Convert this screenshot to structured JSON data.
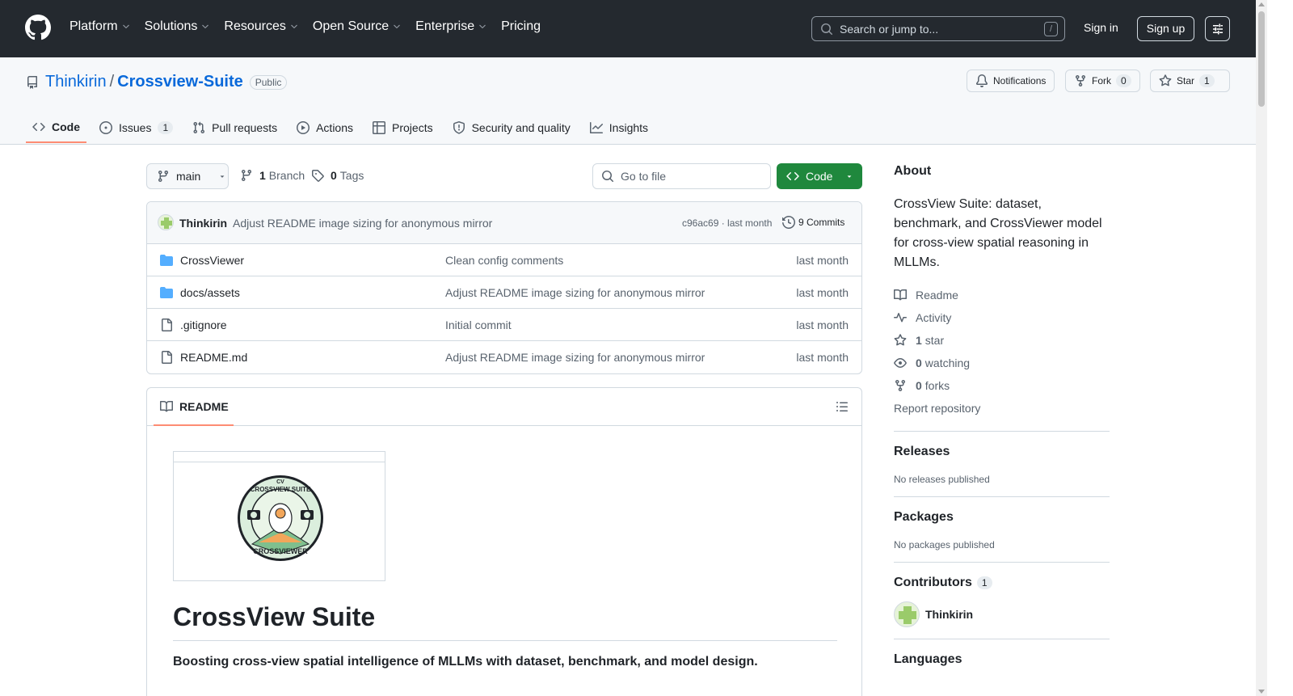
{
  "header": {
    "nav": [
      {
        "label": "Platform",
        "has_dropdown": true
      },
      {
        "label": "Solutions",
        "has_dropdown": true
      },
      {
        "label": "Resources",
        "has_dropdown": true
      },
      {
        "label": "Open Source",
        "has_dropdown": true
      },
      {
        "label": "Enterprise",
        "has_dropdown": true
      },
      {
        "label": "Pricing",
        "has_dropdown": false
      }
    ],
    "search_placeholder": "Search or jump to...",
    "search_shortcut": "/",
    "signin": "Sign in",
    "signup": "Sign up"
  },
  "repo": {
    "owner": "Thinkirin",
    "separator": "/",
    "name": "Crossview-Suite",
    "visibility": "Public",
    "notifications": "Notifications",
    "fork_label": "Fork",
    "fork_count": "0",
    "star_label": "Star",
    "star_count": "1"
  },
  "tabs": [
    {
      "label": "Code",
      "icon": "code-icon",
      "active": true
    },
    {
      "label": "Issues",
      "icon": "issue-icon",
      "count": "1"
    },
    {
      "label": "Pull requests",
      "icon": "pull-request-icon"
    },
    {
      "label": "Actions",
      "icon": "play-icon"
    },
    {
      "label": "Projects",
      "icon": "table-icon"
    },
    {
      "label": "Security and quality",
      "icon": "shield-icon"
    },
    {
      "label": "Insights",
      "icon": "graph-icon"
    }
  ],
  "toolbar": {
    "branch": "main",
    "branch_count": "1",
    "branch_label": "Branch",
    "tag_count": "0",
    "tag_label": "Tags",
    "goto_file": "Go to file",
    "code_button": "Code"
  },
  "latest_commit": {
    "author": "Thinkirin",
    "message": "Adjust README image sizing for anonymous mirror",
    "sha_time": "c96ac69 · last month",
    "commits": "9 Commits"
  },
  "files": [
    {
      "type": "folder",
      "name": "CrossViewer",
      "message": "Clean config comments",
      "time": "last month"
    },
    {
      "type": "folder",
      "name": "docs/assets",
      "message": "Adjust README image sizing for anonymous mirror",
      "time": "last month"
    },
    {
      "type": "file",
      "name": ".gitignore",
      "message": "Initial commit",
      "time": "last month"
    },
    {
      "type": "file",
      "name": "README.md",
      "message": "Adjust README image sizing for anonymous mirror",
      "time": "last month"
    }
  ],
  "readme": {
    "tab_label": "README",
    "title": "CrossView Suite",
    "subtitle": "Boosting cross-view spatial intelligence of MLLMs with dataset, benchmark, and model design.",
    "badge_ring_top": "CROSSVIEW SUITE",
    "badge_ring_bottom": "CROSSVIEWER",
    "badge_top_mark": "CV"
  },
  "about": {
    "heading": "About",
    "description": "CrossView Suite: dataset, benchmark, and CrossViewer model for cross-view spatial reasoning in MLLMs.",
    "readme": "Readme",
    "activity": "Activity",
    "stars_count": "1",
    "stars_label": "star",
    "watching_count": "0",
    "watching_label": "watching",
    "forks_count": "0",
    "forks_label": "forks",
    "report": "Report repository"
  },
  "releases": {
    "heading": "Releases",
    "text": "No releases published"
  },
  "packages": {
    "heading": "Packages",
    "text": "No packages published"
  },
  "contributors": {
    "heading": "Contributors",
    "count": "1",
    "name": "Thinkirin"
  },
  "languages": {
    "heading": "Languages"
  },
  "colors": {
    "header_bg": "#24292f",
    "accent": "#0969da",
    "code_green": "#1f883d",
    "tab_underline": "#fd8c73"
  }
}
